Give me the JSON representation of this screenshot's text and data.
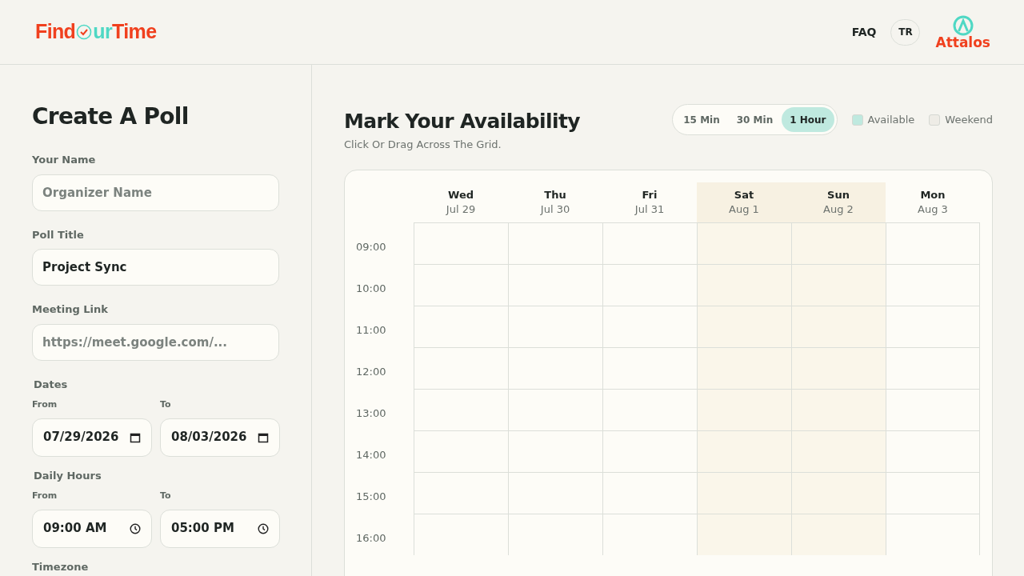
{
  "header": {
    "logo": [
      {
        "text": "Find",
        "color": "#f0401e"
      },
      {
        "text": "ur",
        "color": "#4fd8c4"
      },
      {
        "text": "Time",
        "color": "#f0401e"
      }
    ],
    "faq": "FAQ",
    "language": "TR",
    "partner": "Attalos"
  },
  "poll": {
    "title": "Create A Poll",
    "name": {
      "label": "Your Name",
      "placeholder": "Organizer Name"
    },
    "poll_title": {
      "label": "Poll Title",
      "value": "Project Sync"
    },
    "link": {
      "label": "Meeting Link",
      "placeholder": "https://meet.google.com/..."
    },
    "dates": {
      "label": "Dates",
      "from_label": "From",
      "from": "07/29/2026",
      "to_label": "To",
      "to": "08/03/2026"
    },
    "hours": {
      "label": "Daily Hours",
      "from_label": "From",
      "from": "09:00 AM",
      "to_label": "To",
      "to": "05:00 PM"
    },
    "timezone_label": "Timezone"
  },
  "availability": {
    "title": "Mark Your Availability",
    "subtitle": "Click Or Drag Across The Grid.",
    "intervals": [
      {
        "label": "15 Min",
        "selected": false
      },
      {
        "label": "30 Min",
        "selected": false
      },
      {
        "label": "1 Hour",
        "selected": true
      }
    ],
    "legend": [
      {
        "label": "Available",
        "color": "#bfe9df"
      },
      {
        "label": "Weekend",
        "color": "#eeece6"
      }
    ],
    "days": [
      {
        "day": "Wed",
        "date": "Jul 29",
        "weekend": false
      },
      {
        "day": "Thu",
        "date": "Jul 30",
        "weekend": false
      },
      {
        "day": "Fri",
        "date": "Jul 31",
        "weekend": false
      },
      {
        "day": "Sat",
        "date": "Aug 1",
        "weekend": true
      },
      {
        "day": "Sun",
        "date": "Aug 2",
        "weekend": true
      },
      {
        "day": "Mon",
        "date": "Aug 3",
        "weekend": false
      }
    ],
    "times": [
      "09:00",
      "10:00",
      "11:00",
      "12:00",
      "13:00",
      "14:00",
      "15:00",
      "16:00"
    ]
  }
}
